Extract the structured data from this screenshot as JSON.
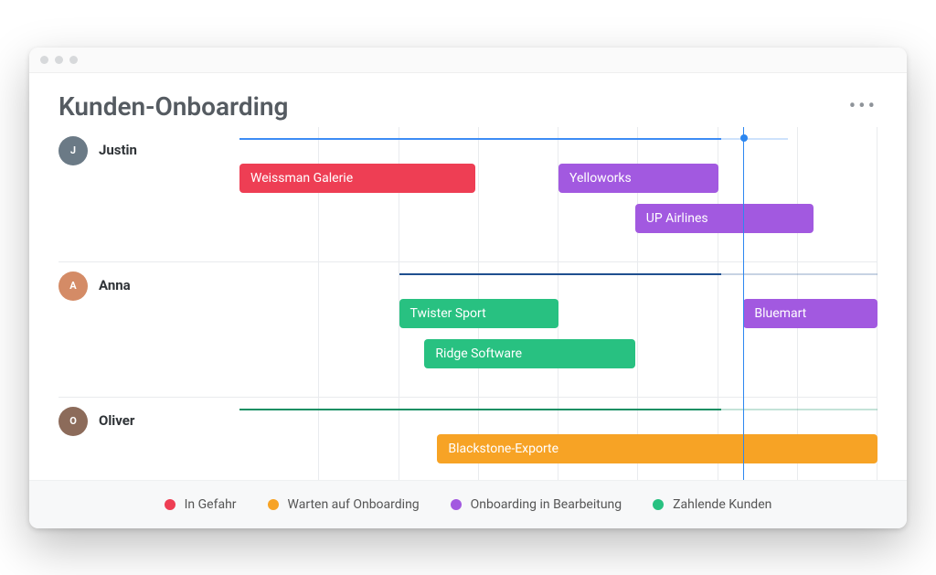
{
  "title": "Kunden-Onboarding",
  "more_label": "•••",
  "today_pct": 75.5,
  "timeline_columns": 8,
  "legend": [
    {
      "label": "In Gefahr",
      "color": "#ee3e54",
      "status": "at-risk"
    },
    {
      "label": "Warten auf Onboarding",
      "color": "#f7a325",
      "status": "waiting"
    },
    {
      "label": "Onboarding in Bearbeitung",
      "color": "#a259e0",
      "status": "in-progress"
    },
    {
      "label": "Zahlende Kunden",
      "color": "#28c181",
      "status": "paying"
    }
  ],
  "people": [
    {
      "name": "Justin",
      "initials": "J",
      "avatar_class": "c1",
      "axis_color": "blue",
      "axis_start": 0,
      "axis_end": 86,
      "tasks": [
        {
          "label": "Weissman Galerie",
          "start": 0,
          "end": 37,
          "row": 0,
          "status": "at-risk"
        },
        {
          "label": "Yelloworks",
          "start": 50,
          "end": 75,
          "row": 0,
          "status": "in-progress"
        },
        {
          "label": "UP Airlines",
          "start": 62,
          "end": 90,
          "row": 1,
          "status": "in-progress"
        }
      ]
    },
    {
      "name": "Anna",
      "initials": "A",
      "avatar_class": "c2",
      "axis_color": "dark",
      "axis_start": 25,
      "axis_end": 100,
      "tasks": [
        {
          "label": "Twister Sport",
          "start": 25,
          "end": 50,
          "row": 0,
          "status": "paying"
        },
        {
          "label": "Bluemart",
          "start": 79,
          "end": 100,
          "row": 0,
          "status": "in-progress"
        },
        {
          "label": "Ridge Software",
          "start": 29,
          "end": 62,
          "row": 1,
          "status": "paying"
        }
      ]
    },
    {
      "name": "Oliver",
      "initials": "O",
      "avatar_class": "c3",
      "axis_color": "green",
      "axis_start": 0,
      "axis_end": 100,
      "tasks": [
        {
          "label": "Blackstone-Exporte",
          "start": 31,
          "end": 100,
          "row": 0,
          "status": "waiting"
        }
      ]
    }
  ],
  "chart_data": {
    "type": "gantt",
    "title": "Kunden-Onboarding",
    "x_axis": {
      "label": "",
      "range_pct": [
        0,
        100
      ],
      "today_pct": 75.5
    },
    "rows": [
      "Justin",
      "Anna",
      "Oliver"
    ],
    "status_colors": {
      "at-risk": "#ee3e54",
      "waiting": "#f7a325",
      "in-progress": "#a259e0",
      "paying": "#28c181"
    },
    "series": [
      {
        "row": "Justin",
        "name": "Weissman Galerie",
        "start": 0,
        "end": 37,
        "status": "at-risk"
      },
      {
        "row": "Justin",
        "name": "Yelloworks",
        "start": 50,
        "end": 75,
        "status": "in-progress"
      },
      {
        "row": "Justin",
        "name": "UP Airlines",
        "start": 62,
        "end": 90,
        "status": "in-progress"
      },
      {
        "row": "Anna",
        "name": "Twister Sport",
        "start": 25,
        "end": 50,
        "status": "paying"
      },
      {
        "row": "Anna",
        "name": "Bluemart",
        "start": 79,
        "end": 100,
        "status": "in-progress"
      },
      {
        "row": "Anna",
        "name": "Ridge Software",
        "start": 29,
        "end": 62,
        "status": "paying"
      },
      {
        "row": "Oliver",
        "name": "Blackstone-Exporte",
        "start": 31,
        "end": 100,
        "status": "waiting"
      }
    ],
    "legend": [
      "In Gefahr",
      "Warten auf Onboarding",
      "Onboarding in Bearbeitung",
      "Zahlende Kunden"
    ]
  }
}
